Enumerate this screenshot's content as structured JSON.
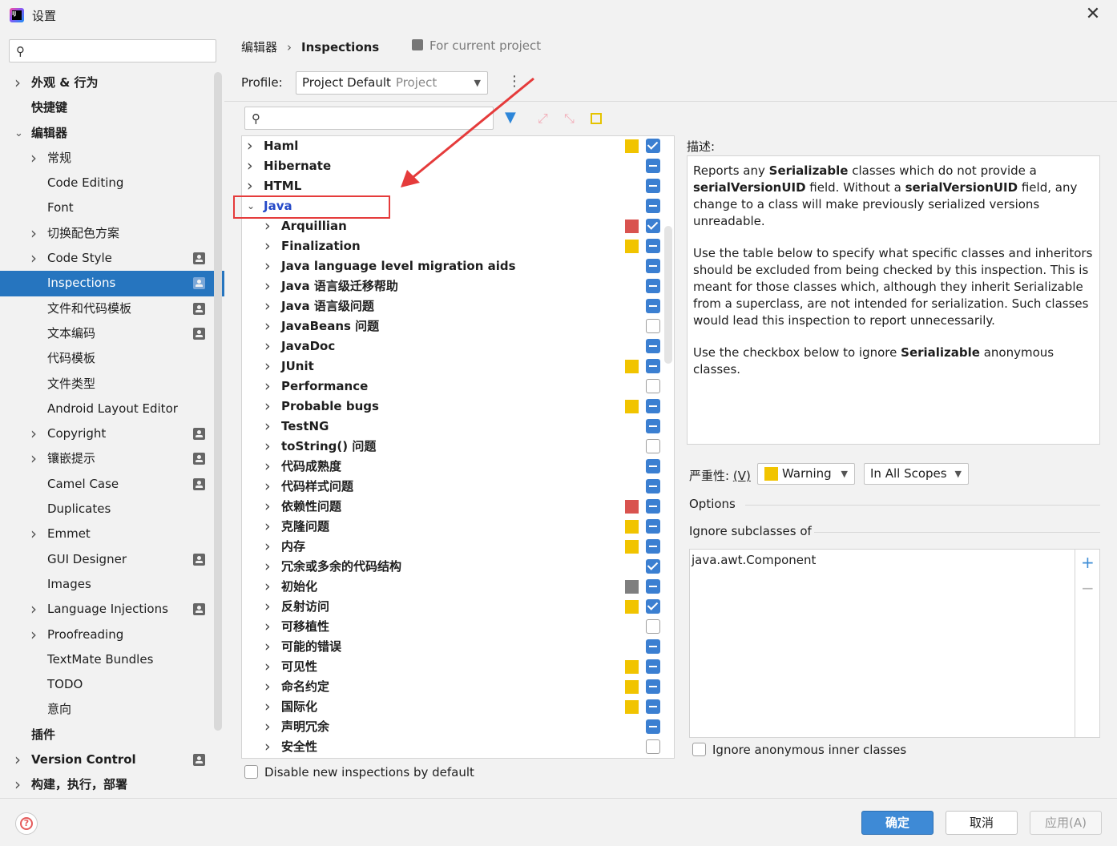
{
  "window": {
    "title": "设置"
  },
  "sidebar": {
    "search_placeholder": "",
    "items": [
      {
        "label": "外观 & 行为",
        "level": 0,
        "arrow": "collapsed",
        "bold": true,
        "project_icon": false
      },
      {
        "label": "快捷键",
        "level": 0,
        "arrow": "none",
        "bold": true,
        "project_icon": false
      },
      {
        "label": "编辑器",
        "level": 0,
        "arrow": "expanded",
        "bold": true,
        "project_icon": false
      },
      {
        "label": "常规",
        "level": 1,
        "arrow": "collapsed",
        "bold": false,
        "project_icon": false
      },
      {
        "label": "Code Editing",
        "level": 1,
        "arrow": "none",
        "bold": false,
        "project_icon": false
      },
      {
        "label": "Font",
        "level": 1,
        "arrow": "none",
        "bold": false,
        "project_icon": false
      },
      {
        "label": "切换配色方案",
        "level": 1,
        "arrow": "collapsed",
        "bold": false,
        "project_icon": false
      },
      {
        "label": "Code Style",
        "level": 1,
        "arrow": "collapsed",
        "bold": false,
        "project_icon": true
      },
      {
        "label": "Inspections",
        "level": 1,
        "arrow": "none",
        "bold": false,
        "project_icon": true,
        "selected": true
      },
      {
        "label": "文件和代码模板",
        "level": 1,
        "arrow": "none",
        "bold": false,
        "project_icon": true
      },
      {
        "label": "文本编码",
        "level": 1,
        "arrow": "none",
        "bold": false,
        "project_icon": true
      },
      {
        "label": "代码模板",
        "level": 1,
        "arrow": "none",
        "bold": false,
        "project_icon": false
      },
      {
        "label": "文件类型",
        "level": 1,
        "arrow": "none",
        "bold": false,
        "project_icon": false
      },
      {
        "label": "Android Layout Editor",
        "level": 1,
        "arrow": "none",
        "bold": false,
        "project_icon": false
      },
      {
        "label": "Copyright",
        "level": 1,
        "arrow": "collapsed",
        "bold": false,
        "project_icon": true
      },
      {
        "label": "镶嵌提示",
        "level": 1,
        "arrow": "collapsed",
        "bold": false,
        "project_icon": true
      },
      {
        "label": "Camel Case",
        "level": 1,
        "arrow": "none",
        "bold": false,
        "project_icon": true
      },
      {
        "label": "Duplicates",
        "level": 1,
        "arrow": "none",
        "bold": false,
        "project_icon": false
      },
      {
        "label": "Emmet",
        "level": 1,
        "arrow": "collapsed",
        "bold": false,
        "project_icon": false
      },
      {
        "label": "GUI Designer",
        "level": 1,
        "arrow": "none",
        "bold": false,
        "project_icon": true
      },
      {
        "label": "Images",
        "level": 1,
        "arrow": "none",
        "bold": false,
        "project_icon": false
      },
      {
        "label": "Language Injections",
        "level": 1,
        "arrow": "collapsed",
        "bold": false,
        "project_icon": true
      },
      {
        "label": "Proofreading",
        "level": 1,
        "arrow": "collapsed",
        "bold": false,
        "project_icon": false
      },
      {
        "label": "TextMate Bundles",
        "level": 1,
        "arrow": "none",
        "bold": false,
        "project_icon": false
      },
      {
        "label": "TODO",
        "level": 1,
        "arrow": "none",
        "bold": false,
        "project_icon": false
      },
      {
        "label": "意向",
        "level": 1,
        "arrow": "none",
        "bold": false,
        "project_icon": false
      },
      {
        "label": "插件",
        "level": 0,
        "arrow": "none",
        "bold": true,
        "project_icon": false
      },
      {
        "label": "Version Control",
        "level": 0,
        "arrow": "collapsed",
        "bold": true,
        "project_icon": true
      },
      {
        "label": "构建，执行，部署",
        "level": 0,
        "arrow": "collapsed",
        "bold": true,
        "project_icon": false
      }
    ]
  },
  "breadcrumb": {
    "parent": "编辑器",
    "separator": "›",
    "current": "Inspections",
    "scope": "For current project"
  },
  "profile": {
    "label": "Profile:",
    "value": "Project Default",
    "suffix": "Project"
  },
  "inspection_search_placeholder": "",
  "inspections": [
    {
      "label": "Haml",
      "level": 0,
      "arrow": "collapsed",
      "severity": "#f1c400",
      "state": "checked"
    },
    {
      "label": "Hibernate",
      "level": 0,
      "arrow": "collapsed",
      "severity": "",
      "state": "partial"
    },
    {
      "label": "HTML",
      "level": 0,
      "arrow": "collapsed",
      "severity": "",
      "state": "partial"
    },
    {
      "label": "Java",
      "level": 0,
      "arrow": "expanded",
      "severity": "",
      "state": "partial",
      "java": true
    },
    {
      "label": "Arquillian",
      "level": 1,
      "arrow": "collapsed",
      "severity": "#d9534f",
      "state": "checked"
    },
    {
      "label": "Finalization",
      "level": 1,
      "arrow": "collapsed",
      "severity": "#f1c400",
      "state": "partial"
    },
    {
      "label": "Java language level migration aids",
      "level": 1,
      "arrow": "collapsed",
      "severity": "",
      "state": "partial"
    },
    {
      "label": "Java 语言级迁移帮助",
      "level": 1,
      "arrow": "collapsed",
      "severity": "",
      "state": "partial"
    },
    {
      "label": "Java 语言级问题",
      "level": 1,
      "arrow": "collapsed",
      "severity": "",
      "state": "partial"
    },
    {
      "label": "JavaBeans 问题",
      "level": 1,
      "arrow": "collapsed",
      "severity": "",
      "state": "empty"
    },
    {
      "label": "JavaDoc",
      "level": 1,
      "arrow": "collapsed",
      "severity": "",
      "state": "partial"
    },
    {
      "label": "JUnit",
      "level": 1,
      "arrow": "collapsed",
      "severity": "#f1c400",
      "state": "partial"
    },
    {
      "label": "Performance",
      "level": 1,
      "arrow": "collapsed",
      "severity": "",
      "state": "empty"
    },
    {
      "label": "Probable bugs",
      "level": 1,
      "arrow": "collapsed",
      "severity": "#f1c400",
      "state": "partial"
    },
    {
      "label": "TestNG",
      "level": 1,
      "arrow": "collapsed",
      "severity": "",
      "state": "partial"
    },
    {
      "label": "toString() 问题",
      "level": 1,
      "arrow": "collapsed",
      "severity": "",
      "state": "empty"
    },
    {
      "label": "代码成熟度",
      "level": 1,
      "arrow": "collapsed",
      "severity": "",
      "state": "partial"
    },
    {
      "label": "代码样式问题",
      "level": 1,
      "arrow": "collapsed",
      "severity": "",
      "state": "partial"
    },
    {
      "label": "依赖性问题",
      "level": 1,
      "arrow": "collapsed",
      "severity": "#d9534f",
      "state": "partial"
    },
    {
      "label": "克隆问题",
      "level": 1,
      "arrow": "collapsed",
      "severity": "#f1c400",
      "state": "partial"
    },
    {
      "label": "内存",
      "level": 1,
      "arrow": "collapsed",
      "severity": "#f1c400",
      "state": "partial"
    },
    {
      "label": "冗余或多余的代码结构",
      "level": 1,
      "arrow": "collapsed",
      "severity": "",
      "state": "checked"
    },
    {
      "label": "初始化",
      "level": 1,
      "arrow": "collapsed",
      "severity": "#7f7f7f",
      "state": "partial"
    },
    {
      "label": "反射访问",
      "level": 1,
      "arrow": "collapsed",
      "severity": "#f1c400",
      "state": "checked"
    },
    {
      "label": "可移植性",
      "level": 1,
      "arrow": "collapsed",
      "severity": "",
      "state": "empty"
    },
    {
      "label": "可能的错误",
      "level": 1,
      "arrow": "collapsed",
      "severity": "",
      "state": "partial"
    },
    {
      "label": "可见性",
      "level": 1,
      "arrow": "collapsed",
      "severity": "#f1c400",
      "state": "partial"
    },
    {
      "label": "命名约定",
      "level": 1,
      "arrow": "collapsed",
      "severity": "#f1c400",
      "state": "partial"
    },
    {
      "label": "国际化",
      "level": 1,
      "arrow": "collapsed",
      "severity": "#f1c400",
      "state": "partial"
    },
    {
      "label": "声明冗余",
      "level": 1,
      "arrow": "collapsed",
      "severity": "",
      "state": "partial"
    },
    {
      "label": "安全性",
      "level": 1,
      "arrow": "collapsed",
      "severity": "",
      "state": "empty"
    }
  ],
  "disable_new_label": "Disable new inspections by default",
  "description": {
    "label": "描述:",
    "p1_a": "Reports any ",
    "p1_b": "Serializable",
    "p1_c": " classes which do not provide a ",
    "p1_d": "serialVersionUID",
    "p1_e": " field. Without a ",
    "p1_f": "serialVersionUID",
    "p1_g": " field, any change to a class will make previously serialized versions unreadable.",
    "p2": "Use the table below to specify what specific classes and inheritors should be excluded from being checked by this inspection. This is meant for those classes which, although they inherit Serializable from a superclass, are not intended for serialization. Such classes would lead this inspection to report unnecessarily.",
    "p3_a": "Use the checkbox below to ignore ",
    "p3_b": "Serializable",
    "p3_c": " anonymous classes."
  },
  "severity": {
    "label_prefix": "严重性:",
    "label_mnemonic": "(V)",
    "value": "Warning",
    "color": "#f1c400",
    "scope": "In All Scopes"
  },
  "options": {
    "label": "Options",
    "ignore_subclasses_label": "Ignore subclasses of",
    "classes": [
      "java.awt.Component"
    ],
    "ignore_anonymous_label": "Ignore anonymous inner classes"
  },
  "footer": {
    "ok": "确定",
    "cancel": "取消",
    "apply": "应用(A)"
  }
}
